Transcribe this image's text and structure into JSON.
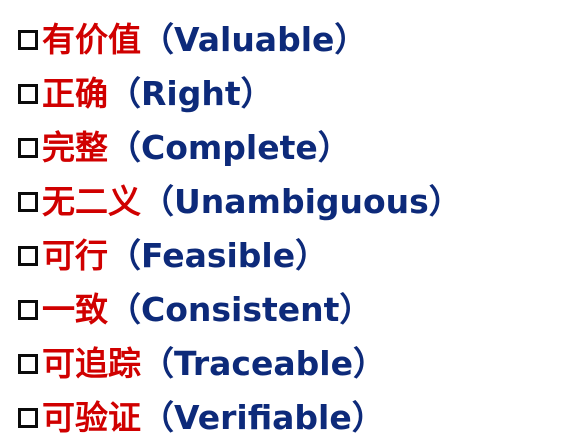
{
  "items": [
    {
      "cn": "有价值",
      "en": "（Valuable）"
    },
    {
      "cn": "正确",
      "en": "（Right）"
    },
    {
      "cn": "完整",
      "en": "（Complete）"
    },
    {
      "cn": "无二义",
      "en": "（Unambiguous）"
    },
    {
      "cn": "可行",
      "en": "（Feasible）"
    },
    {
      "cn": "一致",
      "en": "（Consistent）"
    },
    {
      "cn": "可追踪",
      "en": "（Traceable）"
    },
    {
      "cn": "可验证",
      "en": "（Verifiable）"
    }
  ],
  "colors": {
    "chinese_text": "#d00000",
    "english_text": "#0d2a7a",
    "bullet": "#0b0b0b"
  },
  "icons": {
    "bullet": "hollow-square-bullet-icon"
  }
}
